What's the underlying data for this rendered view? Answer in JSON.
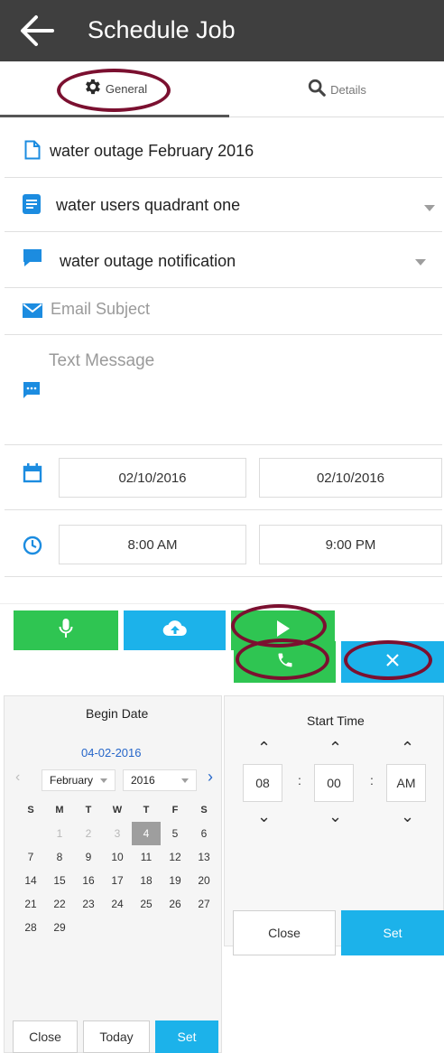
{
  "appbar": {
    "title": "Schedule Job"
  },
  "tabs": [
    {
      "label": "General",
      "icon": "gear-icon"
    },
    {
      "label": "Details",
      "icon": "search-icon"
    }
  ],
  "form": {
    "job_name": "water outage February 2016",
    "group": "water users quadrant one",
    "template": "water outage notification",
    "email_subject_placeholder": "Email Subject",
    "text_message_placeholder": "Text Message",
    "start_date": "02/10/2016",
    "end_date": "02/10/2016",
    "start_time": "8:00 AM",
    "end_time": "9:00 PM"
  },
  "colors": {
    "appbar": "#3f3f3f",
    "accent_green": "#2fc552",
    "accent_blue": "#1cb2ea",
    "icon_blue": "#1c8ce0",
    "annotation": "#7b1030"
  },
  "actions": {
    "row1": [
      "microphone-icon",
      "cloud-upload-icon",
      "play-icon"
    ],
    "row2": [
      "phone-icon",
      "close-icon"
    ]
  },
  "date_picker": {
    "title": "Begin Date",
    "selected_date": "04-02-2016",
    "month": "February",
    "year": "2016",
    "weekdays": [
      "S",
      "M",
      "T",
      "W",
      "T",
      "F",
      "S"
    ],
    "days": [
      "1",
      "2",
      "3",
      "4",
      "5",
      "6",
      "7",
      "8",
      "9",
      "10",
      "11",
      "12",
      "13",
      "14",
      "15",
      "16",
      "17",
      "18",
      "19",
      "20",
      "21",
      "22",
      "23",
      "24",
      "25",
      "26",
      "27",
      "28",
      "29"
    ],
    "selected_day": "4",
    "buttons": {
      "close": "Close",
      "today": "Today",
      "set": "Set"
    }
  },
  "time_picker": {
    "title": "Start Time",
    "hour": "08",
    "minute": "00",
    "period": "AM",
    "buttons": {
      "close": "Close",
      "set": "Set"
    }
  }
}
